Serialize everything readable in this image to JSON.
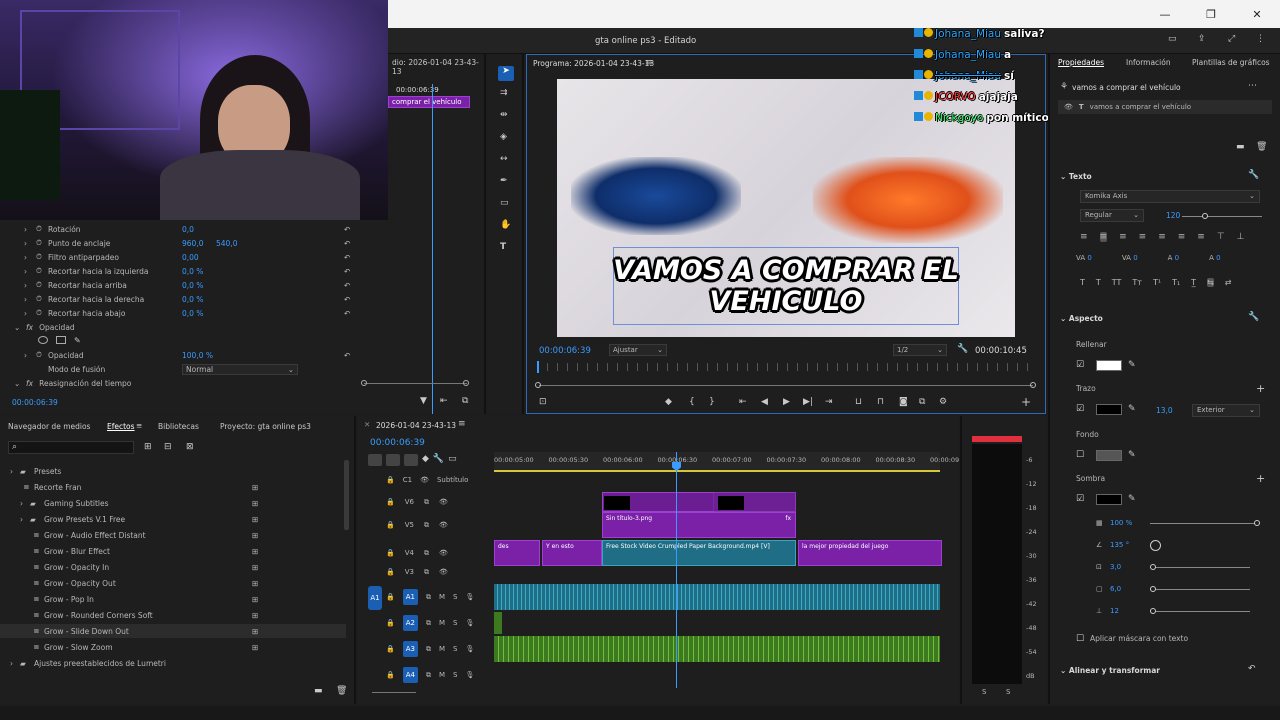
{
  "window": {
    "title": "gta online ps3 - Editado"
  },
  "source_panel": {
    "title": "dio: 2026-01-04 23-43-13",
    "clip_label": "comprar el vehículo",
    "mini_time": "00:00:06:39",
    "timecode": "00:00:06:39",
    "rows": [
      {
        "label": "Rotación",
        "v1": "0,0",
        "v2": ""
      },
      {
        "label": "Punto de anclaje",
        "v1": "960,0",
        "v2": "540,0"
      },
      {
        "label": "Filtro antiparpadeo",
        "v1": "0,00",
        "v2": ""
      },
      {
        "label": "Recortar hacia la izquierda",
        "v1": "0,0 %",
        "v2": ""
      },
      {
        "label": "Recortar hacia arriba",
        "v1": "0,0 %",
        "v2": ""
      },
      {
        "label": "Recortar hacia la derecha",
        "v1": "0,0 %",
        "v2": ""
      },
      {
        "label": "Recortar hacia abajo",
        "v1": "0,0 %",
        "v2": ""
      }
    ],
    "opacity_section": "Opacidad",
    "opacity_label": "Opacidad",
    "opacity_value": "100,0 %",
    "blend_label": "Modo de fusión",
    "blend_value": "Normal",
    "time_remap": "Reasignación del tiempo"
  },
  "program": {
    "title": "Programa: 2026-01-04 23-43-13",
    "timecode": "00:00:06:39",
    "fit": "Ajustar",
    "resolution": "1/2",
    "duration": "00:00:10:45",
    "caption_line1": "VAMOS A COMPRAR EL",
    "caption_line2": "VEHICULO"
  },
  "chat": [
    {
      "user": "Johana_Miau",
      "message": "saliva?",
      "color": "#2aa8ff",
      "strike": false
    },
    {
      "user": "Johana_Miau",
      "message": "a",
      "color": "#2aa8ff",
      "strike": false
    },
    {
      "user": "Johana_Miau",
      "message": "sí",
      "color": "#2aa8ff",
      "strike": true
    },
    {
      "user": "JCORVO",
      "message": "ajajaja",
      "color": "#ff3030",
      "strike": false
    },
    {
      "user": "Nickgoyo",
      "message": "pon mítico en un color mítico el texto",
      "color": "#3cff70",
      "strike": false
    }
  ],
  "effects": {
    "tabs": [
      "Navegador de medios",
      "Efectos",
      "Bibliotecas",
      "Proyecto: gta online ps3"
    ],
    "items": [
      {
        "label": "Presets",
        "indent": 1,
        "icon": "folder"
      },
      {
        "label": "Recorte Fran",
        "indent": 2,
        "icon": "preset"
      },
      {
        "label": "Gaming Subtitles",
        "indent": 2,
        "icon": "folder"
      },
      {
        "label": "Grow Presets V.1 Free",
        "indent": 2,
        "icon": "folder"
      },
      {
        "label": "Grow - Audio Effect Distant",
        "indent": 3,
        "icon": "preset"
      },
      {
        "label": "Grow - Blur Effect",
        "indent": 3,
        "icon": "preset"
      },
      {
        "label": "Grow - Opacity In",
        "indent": 3,
        "icon": "preset"
      },
      {
        "label": "Grow - Opacity Out",
        "indent": 3,
        "icon": "preset"
      },
      {
        "label": "Grow - Pop In",
        "indent": 3,
        "icon": "preset"
      },
      {
        "label": "Grow - Rounded Corners Soft",
        "indent": 3,
        "icon": "preset"
      },
      {
        "label": "Grow - Slide Down Out",
        "indent": 3,
        "icon": "preset"
      },
      {
        "label": "Grow - Slow Zoom",
        "indent": 3,
        "icon": "preset"
      },
      {
        "label": "Ajustes preestablecidos de Lumetri",
        "indent": 1,
        "icon": "folder"
      }
    ]
  },
  "timeline": {
    "sequence": "2026-01-04 23-43-13",
    "timecode": "00:00:06:39",
    "ruler": [
      "00:00:05:00",
      "00:00:05:30",
      "00:00:06:00",
      "00:00:06:30",
      "00:00:07:00",
      "00:00:07:30",
      "00:00:08:00",
      "00:00:08:30",
      "00:00:09"
    ],
    "subtitle_track": "C1",
    "subtitle_label": "Subtítulo",
    "video_tracks": [
      "V6",
      "V5",
      "V4",
      "V3"
    ],
    "audio_tracks": [
      "A1",
      "A2",
      "A3",
      "A4"
    ],
    "source_patch": "A1",
    "clips": {
      "v5": "Sin título-3.png",
      "v4a": "des",
      "v4b": "Y en esto",
      "v4c": "Free Stock Video Crumpled Paper Background.mp4 [V]",
      "v4d": "la mejor propiedad del juego",
      "fx": "fx"
    }
  },
  "meter": {
    "scale": [
      "-6",
      "-12",
      "-18",
      "-24",
      "-30",
      "-36",
      "-42",
      "-48",
      "-54",
      "dB"
    ],
    "solo": [
      "S",
      "S"
    ]
  },
  "properties": {
    "tabs": [
      "Propiedades",
      "Información",
      "Plantillas de gráficos"
    ],
    "layer_title": "vamos a comprar el vehículo",
    "layer_item": "vamos a comprar el vehículo",
    "text_section": "Texto",
    "font": "Komika Axis",
    "style": "Regular",
    "size": "120",
    "tracking": "0",
    "kerning": "0",
    "leading": "0",
    "baseline": "0",
    "appearance": "Aspecto",
    "fill": "Rellenar",
    "fill_color": "#ffffff",
    "stroke": "Trazo",
    "stroke_width": "13,0",
    "stroke_pos": "Exterior",
    "background": "Fondo",
    "shadow": "Sombra",
    "shadow_opacity": "100 %",
    "shadow_angle": "135 °",
    "shadow_distance": "3,0",
    "shadow_size": "6,0",
    "shadow_blur": "12",
    "mask": "Aplicar máscara con texto",
    "align": "Alinear y transformar"
  }
}
